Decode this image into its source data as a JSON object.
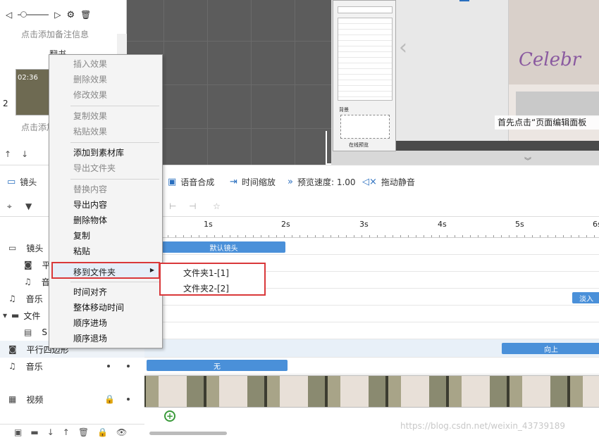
{
  "topleft": {
    "note": "点击添加备注信息",
    "page_label": "翻书",
    "item_time": "02:36",
    "item_index": "2",
    "item_note": "点击添加"
  },
  "toolbar": {
    "camera": "镜头",
    "voice": "语音合成",
    "timescale": "时间缩放",
    "speed": "预览速度: 1.00",
    "mute": "拖动静音"
  },
  "preview": {
    "hint": "首先点击“页面编辑面板",
    "word": "Celebr",
    "dialog_title": "背景",
    "dialog_check": "在线预览"
  },
  "ruler": {
    "ticks": [
      "1s",
      "2s",
      "3s",
      "4s",
      "5s",
      "6s"
    ]
  },
  "tracks": [
    {
      "label": "镜头",
      "icon": "camera-icon"
    },
    {
      "label": "平",
      "icon": "record-icon"
    },
    {
      "label": "音",
      "icon": "music-icon"
    },
    {
      "label": "音乐",
      "icon": "music-icon"
    },
    {
      "label": "文件",
      "icon": "folder-icon"
    },
    {
      "label": "S",
      "icon": "svg-icon"
    },
    {
      "label": "平行四边形",
      "icon": "record-icon"
    },
    {
      "label": "音乐",
      "icon": "music-icon"
    },
    {
      "label": "视频",
      "icon": "film-icon"
    }
  ],
  "bars": {
    "camera": "默认镜头",
    "fadein": "淡入",
    "up": "向上",
    "none": "无"
  },
  "menu": {
    "items": [
      "插入效果",
      "删除效果",
      "修改效果",
      "复制效果",
      "粘贴效果",
      "添加到素材库",
      "导出文件夹",
      "替换内容",
      "导出内容",
      "删除物体",
      "复制",
      "粘贴",
      "移到文件夹",
      "时间对齐",
      "整体移动时间",
      "顺序进场",
      "顺序退场"
    ],
    "submenu": [
      "文件夹1-[1]",
      "文件夹2-[2]"
    ]
  },
  "watermark": "https://blog.csdn.net/weixin_43739189"
}
